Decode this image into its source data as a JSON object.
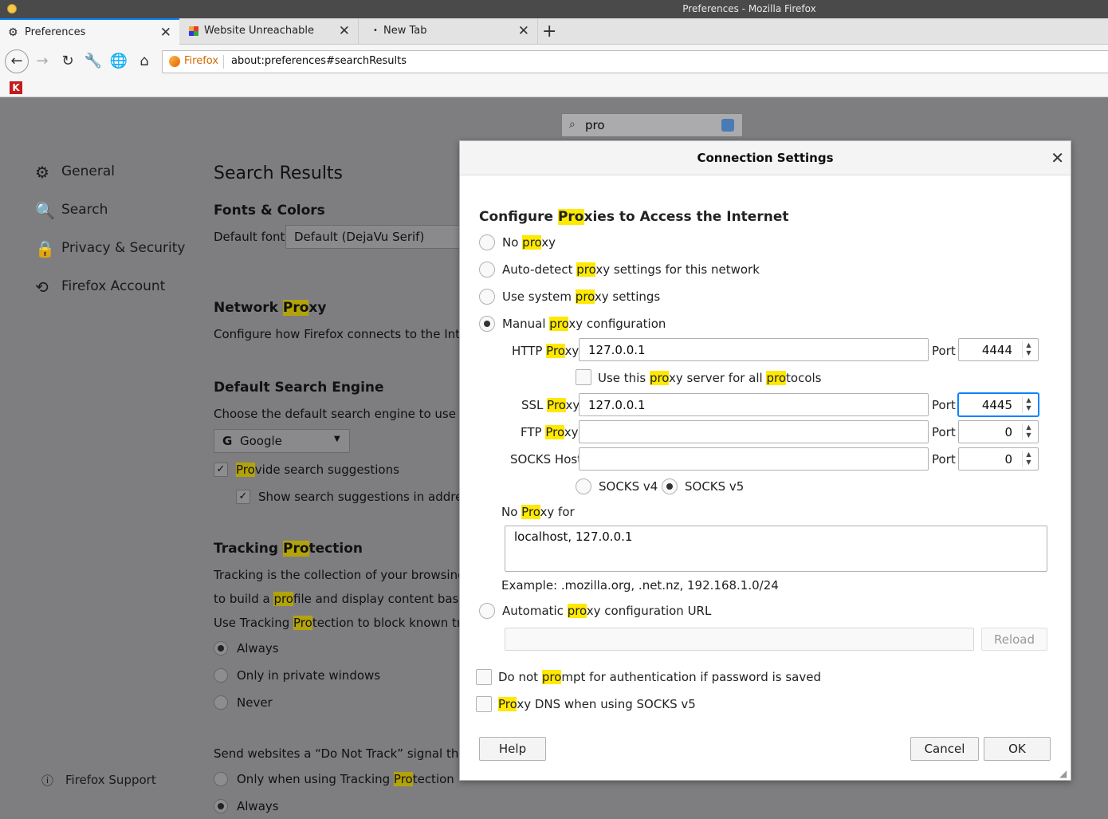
{
  "window": {
    "title": "Preferences - Mozilla Firefox"
  },
  "tabs": [
    {
      "label": "Preferences",
      "icon": "gear-icon"
    },
    {
      "label": "Website Unreachable",
      "icon": "colorful-grid-icon"
    },
    {
      "label": "New Tab",
      "icon": "dot-icon"
    }
  ],
  "toolbar": {
    "identity_label": "Firefox",
    "url": "about:preferences#searchResults"
  },
  "search": {
    "query": "pro"
  },
  "sidebar": {
    "items": [
      {
        "label": "General",
        "icon": "gear-icon"
      },
      {
        "label": "Search",
        "icon": "search-icon"
      },
      {
        "label": "Privacy & Security",
        "icon": "lock-icon"
      },
      {
        "label": "Firefox Account",
        "icon": "sync-icon"
      }
    ],
    "support": "Firefox Support"
  },
  "prefs": {
    "title": "Search Results",
    "fonts_heading": "Fonts & Colors",
    "default_font_label": "Default font",
    "default_font_value": "Default (DejaVu Serif)",
    "network_heading_a": "Network ",
    "network_heading_hl": "Pro",
    "network_heading_b": "xy",
    "network_desc": "Configure how Firefox connects to the Intern",
    "dse_heading": "Default Search Engine",
    "dse_desc": "Choose the default search engine to use in th",
    "engine": "Google",
    "provide_hl": "Pro",
    "provide_rest": "vide search suggestions",
    "show_suggestions": "Show search suggestions in address",
    "tp_heading_a": "Tracking ",
    "tp_heading_hl": "Pro",
    "tp_heading_b": "tection",
    "tp_desc1": "Tracking is the collection of your browsing da",
    "tp_desc2_a": "to build a ",
    "tp_desc2_hl": "pro",
    "tp_desc2_b": "file and display content based o",
    "tp_desc3_a": "Use Tracking ",
    "tp_desc3_hl": "Pro",
    "tp_desc3_b": "tection to block known track",
    "tp_always": "Always",
    "tp_private": "Only in private windows",
    "tp_never": "Never",
    "dnt_desc": "Send websites a “Do Not Track” signal that yo",
    "dnt_only_a": "Only when using Tracking ",
    "dnt_only_hl": "Pro",
    "dnt_only_b": "tection",
    "dnt_always": "Always"
  },
  "dialog": {
    "title": "Connection Settings",
    "heading_a": "Configure ",
    "heading_hl": "Pro",
    "heading_b": "xies to Access the Internet",
    "no_proxy_a": "No ",
    "no_proxy_hl": "pro",
    "no_proxy_b": "xy",
    "auto_a": "Auto-detect ",
    "auto_hl": "pro",
    "auto_b": "xy settings for this network",
    "system_a": "Use system ",
    "system_hl": "pro",
    "system_b": "xy settings",
    "manual_a": "Manual ",
    "manual_hl": "pro",
    "manual_b": "xy configuration",
    "http_label_a": "HTTP ",
    "http_label_hl": "Pro",
    "http_label_b": "xy",
    "http_value": "127.0.0.1",
    "port_label": "Port",
    "http_port": "4444",
    "all_protocols_a": "Use this ",
    "all_protocols_hl": "pro",
    "all_protocols_b": "xy server for all ",
    "all_protocols_hl2": "pro",
    "all_protocols_c": "tocols",
    "ssl_label_a": "SSL ",
    "ssl_label_hl": "Pro",
    "ssl_label_b": "xy",
    "ssl_value": "127.0.0.1",
    "ssl_port": "4445",
    "ftp_label_a": "FTP ",
    "ftp_label_hl": "Pro",
    "ftp_label_b": "xy",
    "ftp_value": "",
    "ftp_port": "0",
    "socks_label": "SOCKS Host",
    "socks_value": "",
    "socks_port": "0",
    "socks_v4": "SOCKS v4",
    "socks_v5": "SOCKS v5",
    "no_proxy_for_a": "No ",
    "no_proxy_for_hl": "Pro",
    "no_proxy_for_b": "xy for",
    "no_proxy_list": "localhost, 127.0.0.1",
    "example": "Example: .mozilla.org, .net.nz, 192.168.1.0/24",
    "pac_a": "Automatic ",
    "pac_hl": "pro",
    "pac_b": "xy configuration URL",
    "pac_value": "",
    "reload": "Reload",
    "no_prompt_a": "Do not ",
    "no_prompt_hl": "pro",
    "no_prompt_b": "mpt for authentication if password is saved",
    "dns_hl": "Pro",
    "dns_b": "xy DNS when using SOCKS v5",
    "help": "Help",
    "cancel": "Cancel",
    "ok": "OK"
  },
  "colors": {
    "accent": "#0a84ff",
    "highlight": "#ffe900",
    "overlay": "#7e7e80"
  }
}
